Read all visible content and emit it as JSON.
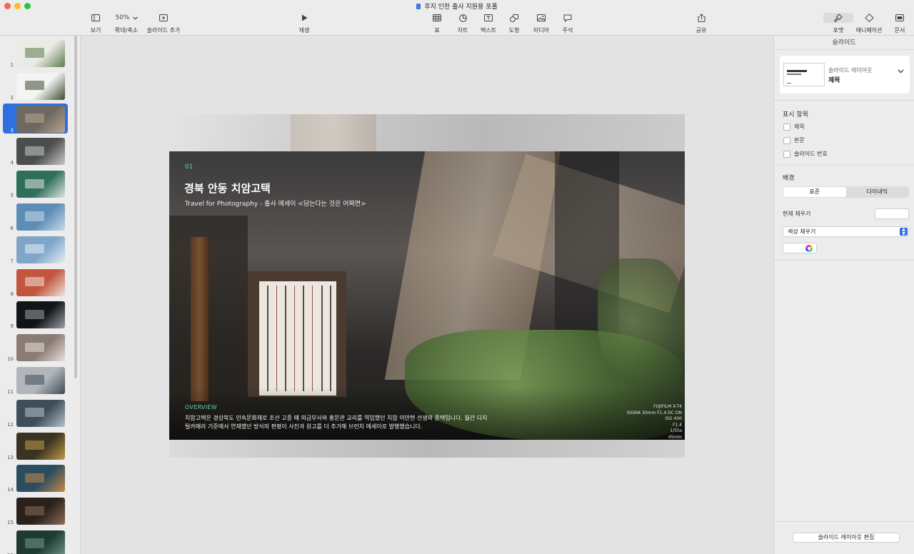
{
  "window": {
    "title": "후지 인천 출사 지원용 포폴",
    "traffic_lights": {
      "close": "#fe5f57",
      "minimize": "#febc2e",
      "zoom": "#28c840"
    }
  },
  "toolbar": {
    "view_label": "보기",
    "zoom_value": "50%",
    "zoom_label": "확대/축소",
    "add_slide_label": "슬라이드 추가",
    "play_label": "재생",
    "table_label": "표",
    "chart_label": "차트",
    "text_label": "텍스트",
    "shape_label": "도형",
    "media_label": "미디어",
    "comment_label": "주석",
    "share_label": "공유",
    "format_label": "포맷",
    "animate_label": "애니메이션",
    "document_label": "문서"
  },
  "navigator": {
    "selected_slide": 3,
    "slides": [
      {
        "number": "1",
        "color": "#e9ece4",
        "accent": "#5d7a4f"
      },
      {
        "number": "2",
        "color": "#f4f4f4",
        "accent": "#3d4a2f"
      },
      {
        "number": "3",
        "color": "#6e6863",
        "accent": "#b9a58e"
      },
      {
        "number": "4",
        "color": "#4b4d4e",
        "accent": "#c8c8c8"
      },
      {
        "number": "5",
        "color": "#2f6e5a",
        "accent": "#dfe6e2"
      },
      {
        "number": "6",
        "color": "#5d8db6",
        "accent": "#c8daea"
      },
      {
        "number": "7",
        "color": "#7fa6c9",
        "accent": "#e6eef5"
      },
      {
        "number": "8",
        "color": "#c2553e",
        "accent": "#efe3db"
      },
      {
        "number": "9",
        "color": "#121416",
        "accent": "#9aa0a6"
      },
      {
        "number": "10",
        "color": "#8b7b75",
        "accent": "#e8e1dc"
      },
      {
        "number": "11",
        "color": "#b2b6bb",
        "accent": "#3f4a57"
      },
      {
        "number": "12",
        "color": "#3e4e5a",
        "accent": "#b6c2cb"
      },
      {
        "number": "13",
        "color": "#3b3321",
        "accent": "#c29a4a"
      },
      {
        "number": "14",
        "color": "#2c4d5e",
        "accent": "#c98a48"
      },
      {
        "number": "15",
        "color": "#2a211c",
        "accent": "#8d6d58"
      },
      {
        "number": "16",
        "color": "#1f3a33",
        "accent": "#6f9a8a"
      }
    ]
  },
  "slide": {
    "number": "01",
    "title": "경북 안동 치암고택",
    "subtitle": "Travel for Photography - 출사 에세이 <담는다는 것은 어찌면>",
    "overview_label": "OVERVIEW",
    "overview_body": "치암고택은 경상북도 민속문화재로 조선 고종 때 의금부사와 홍문관 교리를 역임했던 치암 이만현 선생의 종택입니다. 월간 디지털카메라 기준에서 연재했던 방식의 편평이 사진과 원고를 더 추가해 브런치 에세이로 발행했습니다.",
    "exif": [
      "FUJIFILM X-T4",
      "SIGMA 30mm F1.4 DC DN",
      "ISO 400",
      "F1.4",
      "1/55s",
      "45mm"
    ],
    "accent_color": "#5ed3a6"
  },
  "inspector": {
    "header": "슬라이드",
    "layout_caption": "슬라이드 레이아웃",
    "layout_name": "제목",
    "layout_thumb_title": "프레젠테이션 제목",
    "show_section_title": "표시 항목",
    "show_items": [
      "제목",
      "본문",
      "슬라이드 번호"
    ],
    "background_title": "배경",
    "bg_tabs": [
      "표준",
      "다이내믹"
    ],
    "current_fill_label": "현재 채우기",
    "fill_type": "색상 채우기",
    "edit_layout_button": "슬라이드 레이아웃 편집",
    "selection_color": "#2f6fe0"
  }
}
